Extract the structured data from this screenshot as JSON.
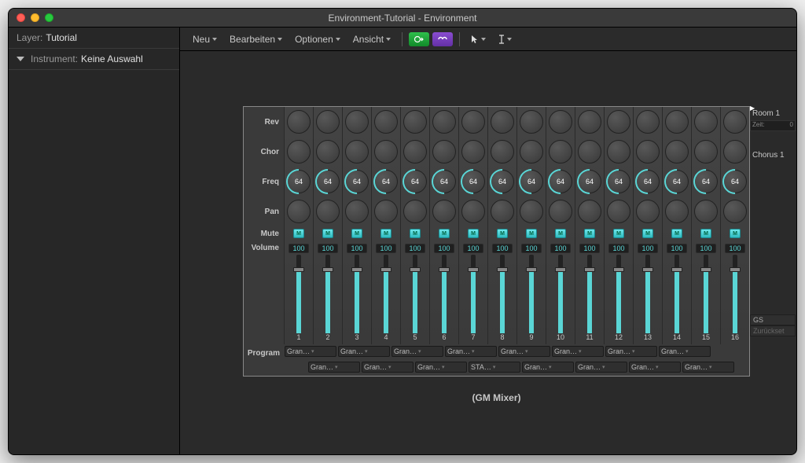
{
  "window": {
    "title": "Environment-Tutorial - Environment"
  },
  "sidebar": {
    "layer_label": "Layer:",
    "layer_value": "Tutorial",
    "instrument_label": "Instrument:",
    "instrument_value": "Keine Auswahl"
  },
  "toolbar": {
    "menus": [
      "Neu",
      "Bearbeiten",
      "Optionen",
      "Ansicht"
    ]
  },
  "mixer": {
    "title": "(GM Mixer)",
    "row_labels": {
      "rev": "Rev",
      "chor": "Chor",
      "freq": "Freq",
      "pan": "Pan",
      "mute": "Mute",
      "volume": "Volume",
      "program": "Program"
    },
    "channels": [
      {
        "n": 1,
        "freq": 64,
        "vol": 100
      },
      {
        "n": 2,
        "freq": 64,
        "vol": 100
      },
      {
        "n": 3,
        "freq": 64,
        "vol": 100
      },
      {
        "n": 4,
        "freq": 64,
        "vol": 100
      },
      {
        "n": 5,
        "freq": 64,
        "vol": 100
      },
      {
        "n": 6,
        "freq": 64,
        "vol": 100
      },
      {
        "n": 7,
        "freq": 64,
        "vol": 100
      },
      {
        "n": 8,
        "freq": 64,
        "vol": 100
      },
      {
        "n": 9,
        "freq": 64,
        "vol": 100
      },
      {
        "n": 10,
        "freq": 64,
        "vol": 100
      },
      {
        "n": 11,
        "freq": 64,
        "vol": 100
      },
      {
        "n": 12,
        "freq": 64,
        "vol": 100
      },
      {
        "n": 13,
        "freq": 64,
        "vol": 100
      },
      {
        "n": 14,
        "freq": 64,
        "vol": 100
      },
      {
        "n": 15,
        "freq": 64,
        "vol": 100
      },
      {
        "n": 16,
        "freq": 64,
        "vol": 100
      }
    ],
    "programs_row1": [
      "Gran…",
      "Gran…",
      "Gran…",
      "Gran…",
      "Gran…",
      "Gran…",
      "Gran…",
      "Gran…"
    ],
    "programs_row2": [
      "Gran…",
      "Gran…",
      "Gran…",
      "STA…",
      "Gran…",
      "Gran…",
      "Gran…",
      "Gran…"
    ],
    "mute_glyph": "M"
  },
  "right": {
    "room": "Room 1",
    "time_label": "Zeit:",
    "time_value": "0",
    "chorus": "Chorus 1",
    "gs": "GS",
    "reset": "Zurückset"
  }
}
